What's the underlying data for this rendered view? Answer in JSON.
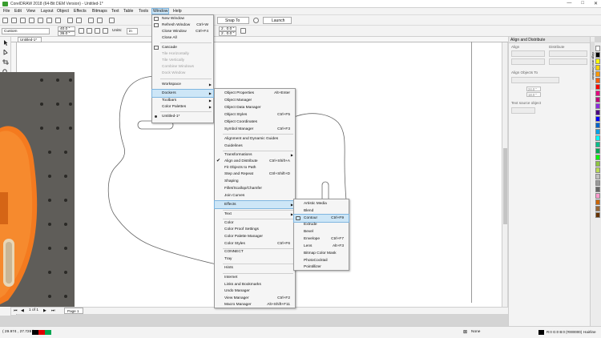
{
  "app": {
    "title": "CorelDRAW 2018 (64-Bit DEM Version) - Untitled-1*",
    "controls": [
      "—",
      "□",
      "✕"
    ]
  },
  "menubar": {
    "items": [
      "File",
      "Edit",
      "View",
      "Layout",
      "Object",
      "Effects",
      "Bitmaps",
      "Text",
      "Table",
      "Tools",
      "Window",
      "Help"
    ]
  },
  "toolbar": {
    "snap_label": "Snap To",
    "launch_label": "Launch"
  },
  "propbar": {
    "preset": "Custom",
    "width": "40.0 \"",
    "height": "36.0 \"",
    "units_label": "Units:",
    "units_value": "in",
    "nudge_x": "2 . 0.0 \"",
    "nudge_y": "2 . 0.0 \""
  },
  "document": {
    "tab_label": "Untitled-1*",
    "page_nav": "1 of 1",
    "page_tab": "Page 1"
  },
  "window_menu": {
    "items": [
      {
        "label": "New Window",
        "shortcut": "",
        "state": "enabled"
      },
      {
        "label": "Refresh Window",
        "shortcut": "Ctrl+W",
        "state": "enabled"
      },
      {
        "label": "Close Window",
        "shortcut": "Ctrl+F4",
        "state": "enabled"
      },
      {
        "label": "Close All",
        "shortcut": "",
        "state": "enabled"
      },
      {
        "label": "Cascade",
        "shortcut": "",
        "state": "enabled"
      },
      {
        "label": "Tile Horizontally",
        "shortcut": "",
        "state": "disabled"
      },
      {
        "label": "Tile Vertically",
        "shortcut": "",
        "state": "disabled"
      },
      {
        "label": "Combine Windows",
        "shortcut": "",
        "state": "disabled"
      },
      {
        "label": "Dock Window",
        "shortcut": "",
        "state": "disabled"
      },
      {
        "label": "Workspace",
        "shortcut": "",
        "state": "submenu"
      },
      {
        "label": "Dockers",
        "shortcut": "",
        "state": "submenu-open"
      },
      {
        "label": "Toolbars",
        "shortcut": "",
        "state": "submenu"
      },
      {
        "label": "Color Palettes",
        "shortcut": "",
        "state": "submenu"
      },
      {
        "label": "Untitled-1*",
        "shortcut": "",
        "state": "selected"
      }
    ]
  },
  "dockers_menu": {
    "items": [
      {
        "label": "Object Properties",
        "shortcut": "Alt+Enter",
        "state": "enabled"
      },
      {
        "label": "Object Manager",
        "shortcut": "",
        "state": "enabled"
      },
      {
        "label": "Object Data Manager",
        "shortcut": "",
        "state": "enabled"
      },
      {
        "label": "Object Styles",
        "shortcut": "Ctrl+F5",
        "state": "enabled"
      },
      {
        "label": "Object Coordinates",
        "shortcut": "",
        "state": "enabled"
      },
      {
        "label": "Symbol Manager",
        "shortcut": "Ctrl+F3",
        "state": "enabled"
      },
      {
        "label": "Alignment and Dynamic Guides",
        "shortcut": "",
        "state": "enabled"
      },
      {
        "label": "Guidelines",
        "shortcut": "",
        "state": "enabled"
      },
      {
        "label": "Transformations",
        "shortcut": "",
        "state": "submenu"
      },
      {
        "label": "Align and Distribute",
        "shortcut": "Ctrl+Shift+A",
        "state": "checked"
      },
      {
        "label": "Fit Objects to Path",
        "shortcut": "",
        "state": "enabled"
      },
      {
        "label": "Step and Repeat",
        "shortcut": "Ctrl+Shift+D",
        "state": "enabled"
      },
      {
        "label": "Shaping",
        "shortcut": "",
        "state": "enabled"
      },
      {
        "label": "Fillet/Scallop/Chamfer",
        "shortcut": "",
        "state": "enabled"
      },
      {
        "label": "Join Curves",
        "shortcut": "",
        "state": "enabled"
      },
      {
        "label": "Effects",
        "shortcut": "",
        "state": "submenu-open"
      },
      {
        "label": "Text",
        "shortcut": "",
        "state": "submenu"
      },
      {
        "label": "Color",
        "shortcut": "",
        "state": "enabled"
      },
      {
        "label": "Color Proof Settings",
        "shortcut": "",
        "state": "enabled"
      },
      {
        "label": "Color Palette Manager",
        "shortcut": "",
        "state": "enabled"
      },
      {
        "label": "Color Styles",
        "shortcut": "Ctrl+F6",
        "state": "enabled"
      },
      {
        "label": "CONNECT",
        "shortcut": "",
        "state": "enabled"
      },
      {
        "label": "Tray",
        "shortcut": "",
        "state": "enabled"
      },
      {
        "label": "Hints",
        "shortcut": "",
        "state": "enabled"
      },
      {
        "label": "Internet",
        "shortcut": "",
        "state": "enabled"
      },
      {
        "label": "Links and Bookmarks",
        "shortcut": "",
        "state": "enabled"
      },
      {
        "label": "Undo Manager",
        "shortcut": "",
        "state": "enabled"
      },
      {
        "label": "View Manager",
        "shortcut": "Ctrl+F2",
        "state": "enabled"
      },
      {
        "label": "Macro Manager",
        "shortcut": "Alt+Shift+F11",
        "state": "enabled"
      }
    ]
  },
  "effects_menu": {
    "items": [
      {
        "label": "Artistic Media",
        "shortcut": "",
        "state": "enabled"
      },
      {
        "label": "Blend",
        "shortcut": "",
        "state": "enabled"
      },
      {
        "label": "Contour",
        "shortcut": "Ctrl+F9",
        "state": "highlighted"
      },
      {
        "label": "Extrude",
        "shortcut": "",
        "state": "enabled"
      },
      {
        "label": "Bevel",
        "shortcut": "",
        "state": "enabled"
      },
      {
        "label": "Envelope",
        "shortcut": "Ctrl+F7",
        "state": "enabled"
      },
      {
        "label": "Lens",
        "shortcut": "Alt+F3",
        "state": "enabled"
      },
      {
        "label": "Bitmap Color Mask",
        "shortcut": "",
        "state": "enabled"
      },
      {
        "label": "PhotoCocktail",
        "shortcut": "",
        "state": "enabled"
      },
      {
        "label": "Pointillizer",
        "shortcut": "",
        "state": "enabled"
      }
    ]
  },
  "docker": {
    "title": "Align and Distribute",
    "side_tab": "Align and Distribute",
    "sections": [
      "Align",
      "Distribute",
      "Align Objects To",
      "Text source object"
    ],
    "field_a": "24.0 \"",
    "field_b": "18.0 \""
  },
  "status": {
    "coords": "( 29.974 , 27.728 )",
    "fill_label": "None",
    "outline_color": "R:0 G:0 B:0 (#000000)",
    "outline_width": "Hairline"
  },
  "palette": {
    "colors": [
      "#ffffff",
      "#000000",
      "#ffff00",
      "#ffd200",
      "#ff9900",
      "#ff5a00",
      "#ff0000",
      "#e6007e",
      "#c0007a",
      "#8a2be2",
      "#4b0082",
      "#0000ff",
      "#0066cc",
      "#00a0e9",
      "#00ffff",
      "#00c08b",
      "#00a650",
      "#00ff00",
      "#8dc63f",
      "#bada55",
      "#c0c0c0",
      "#999999",
      "#666666",
      "#ff99cc",
      "#cc6600",
      "#996633",
      "#663300"
    ]
  },
  "colors": {
    "menu_highlight": "#cde6f7",
    "accent": "#7fb6e0",
    "guitar_orange": "#f47a1f"
  }
}
